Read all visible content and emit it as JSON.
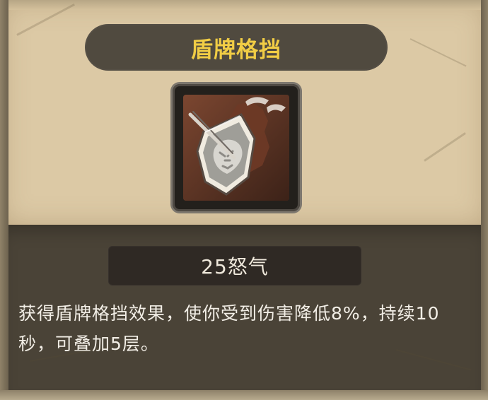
{
  "skill": {
    "title": "盾牌格挡",
    "cost": "25怒气",
    "description": "获得盾牌格挡效果，使你受到伤害降低8%，持续10秒，可叠加5层。"
  },
  "icon": {
    "name": "shield-block-icon",
    "colors": {
      "background": "#5b3322",
      "shield_outline": "#f0ebe0",
      "shield_fill": "#9f9e98",
      "shield_mark": "#d8d6d0"
    }
  },
  "colors": {
    "parchment": "#dcc9a5",
    "dark_panel": "#4a4337",
    "title_bar": "#504a3f",
    "title_text": "#f1cd45",
    "cost_bar": "#2f2924",
    "text_light": "#f2eee6"
  }
}
